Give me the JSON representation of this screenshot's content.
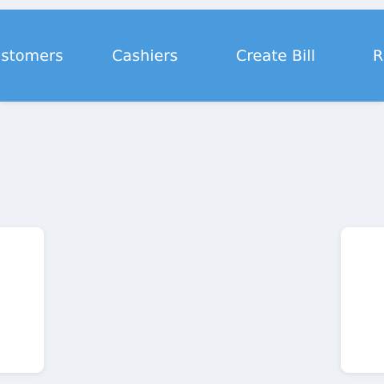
{
  "navbar": {
    "items": [
      {
        "label": "Customers"
      },
      {
        "label": "Cashiers"
      },
      {
        "label": "Create Bill"
      },
      {
        "label": "R"
      }
    ]
  },
  "colors": {
    "navbar_background": "#4a9ade",
    "page_background": "#eef2f7",
    "card_background": "#ffffff",
    "nav_text": "#ffffff"
  }
}
